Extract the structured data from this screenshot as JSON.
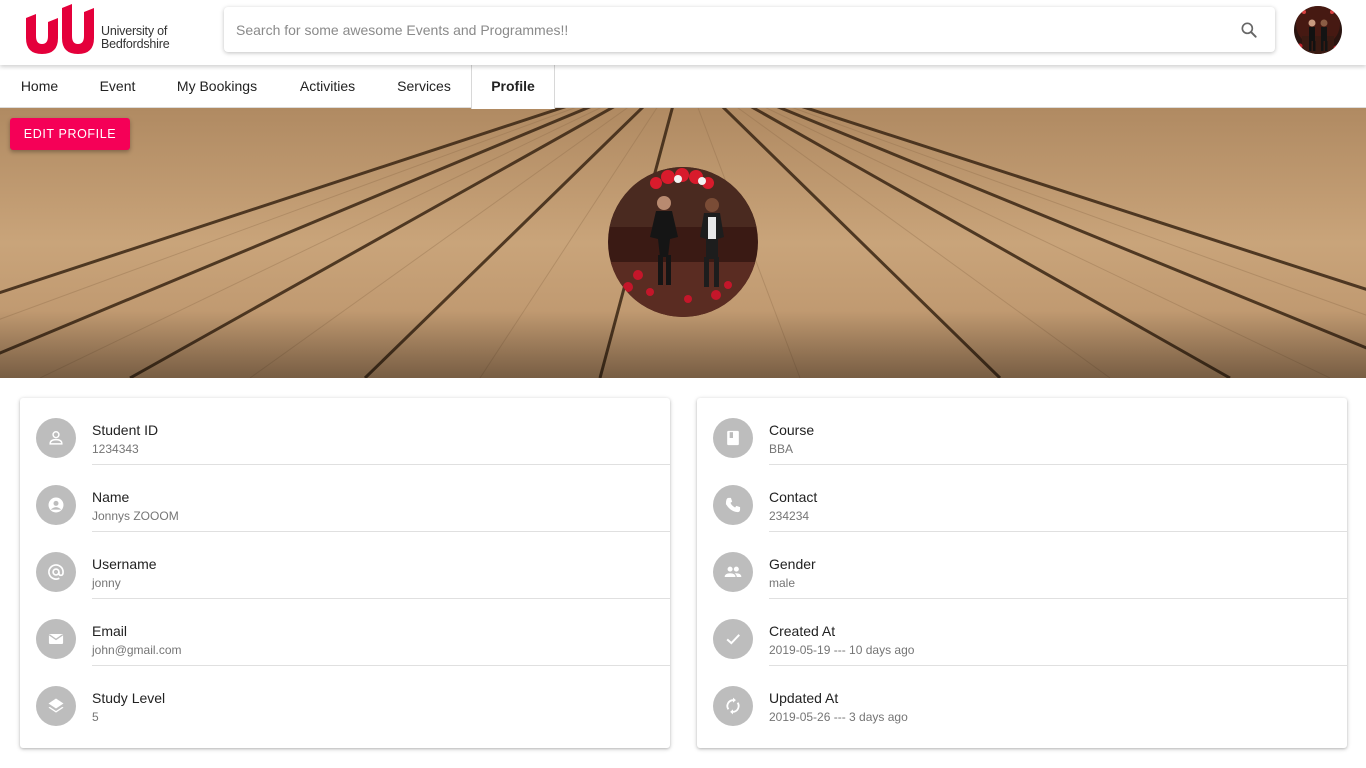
{
  "header": {
    "logo_line1": "University of",
    "logo_line2": "Bedfordshire",
    "search_placeholder": "Search for some awesome Events and Programmes!!",
    "search_value": ""
  },
  "nav": {
    "items": [
      {
        "label": "Home"
      },
      {
        "label": "Event"
      },
      {
        "label": "My Bookings"
      },
      {
        "label": "Activities"
      },
      {
        "label": "Services"
      },
      {
        "label": "Profile"
      }
    ],
    "active": "Profile"
  },
  "banner": {
    "edit_label": "EDIT PROFILE"
  },
  "left_card": [
    {
      "title": "Student ID",
      "value": "1234343",
      "icon": "person-outline-icon"
    },
    {
      "title": "Name",
      "value": "Jonnys ZOOOM",
      "icon": "account-circle-icon"
    },
    {
      "title": "Username",
      "value": "jonny",
      "icon": "at-sign-icon"
    },
    {
      "title": "Email",
      "value": "john@gmail.com",
      "icon": "email-icon"
    },
    {
      "title": "Study Level",
      "value": "5",
      "icon": "layers-icon"
    }
  ],
  "right_card": [
    {
      "title": "Course",
      "value": "BBA",
      "icon": "book-icon"
    },
    {
      "title": "Contact",
      "value": "234234",
      "icon": "phone-icon"
    },
    {
      "title": "Gender",
      "value": "male",
      "icon": "people-icon"
    },
    {
      "title": "Created At",
      "value": "2019-05-19 --- 10 days ago",
      "icon": "check-icon"
    },
    {
      "title": "Updated At",
      "value": "2019-05-26 --- 3 days ago",
      "icon": "sync-icon"
    }
  ],
  "colors": {
    "accent": "#f50057",
    "brand_red": "#e4003b",
    "icon_circle": "#bdbdbd"
  }
}
